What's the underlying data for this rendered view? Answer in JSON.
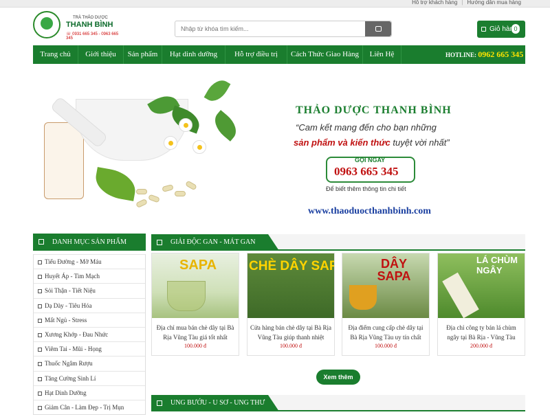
{
  "topbar": {
    "links": [
      "Hỗ trợ khách hàng",
      "Hướng dẫn mua hàng"
    ]
  },
  "logo": {
    "small": "TRÀ THẢO DƯỢC",
    "name": "THANH BÌNH",
    "phone": "☏ 0931 665 345 - 0963 665 345"
  },
  "search": {
    "placeholder": "Nhập từ khóa tìm kiếm..."
  },
  "cart": {
    "label": "Giỏ hàng",
    "count": "0"
  },
  "nav": {
    "items": [
      "Trang chủ",
      "Giới thiệu",
      "Sản phẩm",
      "Hạt dinh dưỡng",
      "Hỗ trợ điều trị",
      "Cách Thức Giao Hàng",
      "Liên Hệ"
    ],
    "hotline_label": "HOTLINE:",
    "hotline_number": "0962 665 345"
  },
  "banner": {
    "title": "THẢO DƯỢC THANH BÌNH",
    "quote_line1": "“Cam kết mang đến cho bạn những",
    "quote_red": "sản phẩm và kiến thức",
    "quote_rest": " tuyệt vời nhất”",
    "call_label": "GỌI NGAY",
    "call_number": "0963 665 345",
    "info": "Để biết thêm thông tin chi tiết",
    "url": "www.thaoduocthanhbinh.com"
  },
  "sidebar": {
    "title": "DANH MỤC SẢN PHẨM",
    "items": [
      "Tiểu Đường - Mỡ Máu",
      "Huyết Áp - Tim Mạch",
      "Sỏi Thận - Tiết Niệu",
      "Dạ Dày - Tiêu Hóa",
      "Mất Ngủ - Stress",
      "Xương Khớp - Đau Nhức",
      "Viêm Tai - Mũi - Họng",
      "Thuốc Ngâm Rượu",
      "Tăng Cường Sinh Lí",
      "Hạt Dinh Dưỡng",
      "Giảm Cân - Làm Đẹp - Trị Mụn"
    ]
  },
  "section1": {
    "title": "GIẢI ĐỘC GAN - MÁT GAN",
    "products": [
      {
        "img_text": "SAPA",
        "name": "Địa chỉ mua bán chè dây tại Bà Rịa Vũng Tàu giá tốt nhất",
        "price": "100.000 đ"
      },
      {
        "img_text": "CHÈ DÂY SAPA",
        "name": "Cửa hàng bán chè dây tại Bà Rịa Vũng Tàu giúp thanh nhiệt",
        "price": "100.000 đ"
      },
      {
        "img_text": "DÂY SAPA",
        "name": "Địa điểm cung cấp chè dây tại Bà Rịa Vũng Tàu uy tín chất",
        "price": "100.000 đ"
      },
      {
        "img_text": "LÁ CHÙM NGÂY",
        "name": "Địa chỉ công ty bán lá chùm ngây tại Bà Rịa - Vũng Tàu",
        "price": "200.000 đ"
      }
    ],
    "more": "Xem thêm"
  },
  "section2": {
    "title": "UNG BƯỚU - U SƠ - UNG THƯ"
  },
  "colors": {
    "brand_green": "#1a7d2e",
    "price_red": "#c01010",
    "hotline_yellow": "#ffe400"
  }
}
